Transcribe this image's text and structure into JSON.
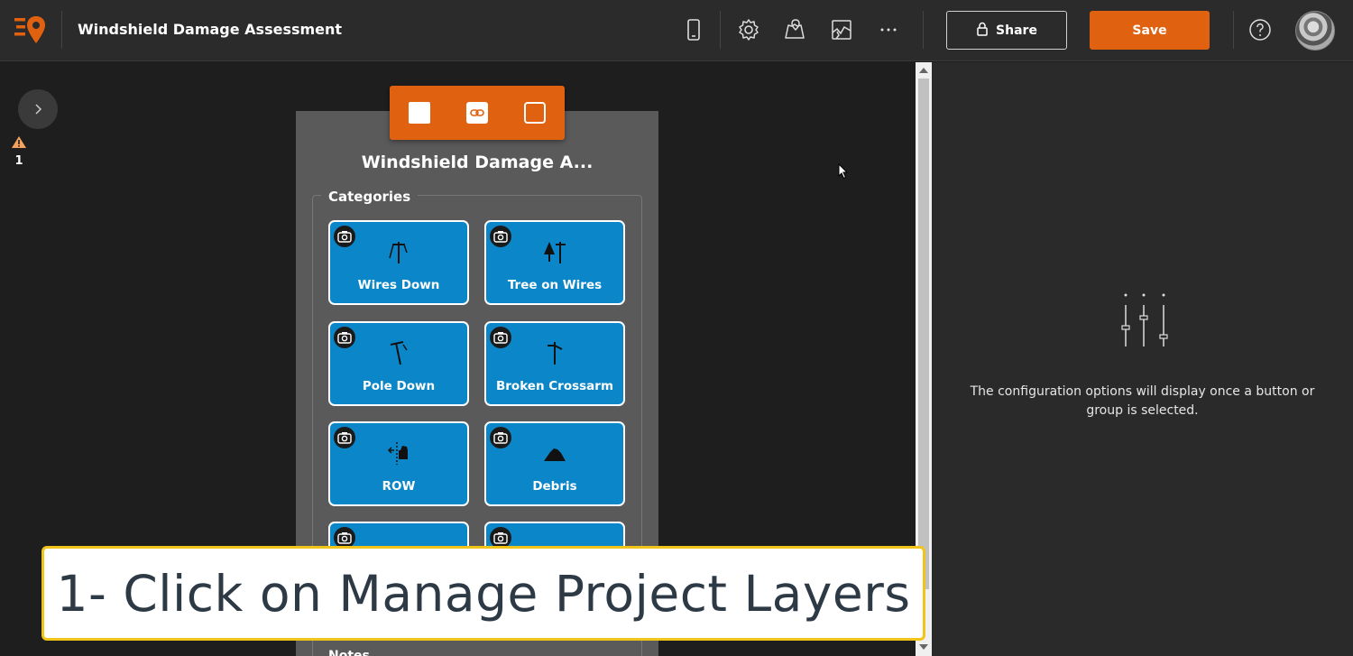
{
  "header": {
    "app_title": "Windshield Damage Assessment",
    "share_label": "Share",
    "save_label": "Save",
    "icons": [
      "phone-preview-icon",
      "settings-gear-icon",
      "map-icon",
      "project-layers-icon",
      "more-icon",
      "help-icon"
    ]
  },
  "left_rail": {
    "warning_count": "1"
  },
  "preview": {
    "title": "Windshield Damage A...",
    "group_label": "Categories",
    "buttons": [
      {
        "label": "Wires Down",
        "icon": "wires-down-icon"
      },
      {
        "label": "Tree on Wires",
        "icon": "tree-on-wires-icon"
      },
      {
        "label": "Pole Down",
        "icon": "pole-down-icon"
      },
      {
        "label": "Broken Crossarm",
        "icon": "broken-crossarm-icon"
      },
      {
        "label": "ROW",
        "icon": "row-icon"
      },
      {
        "label": "Debris",
        "icon": "debris-icon"
      }
    ],
    "notes_label": "Notes"
  },
  "right_panel": {
    "message": "The configuration options will display once a button or group is selected."
  },
  "caption": {
    "text": "1- Click on Manage Project Layers"
  },
  "colors": {
    "accent": "#e0610f",
    "button_blue": "#0b86c8",
    "caption_border": "#f0c419"
  }
}
